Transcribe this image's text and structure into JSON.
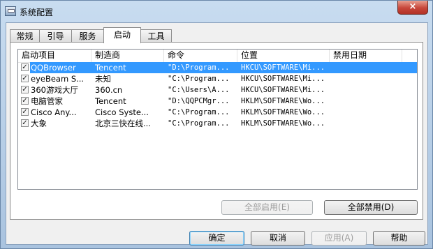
{
  "window": {
    "title": "系统配置",
    "close_symbol": "×"
  },
  "tabs": [
    {
      "label": "常规"
    },
    {
      "label": "引导"
    },
    {
      "label": "服务"
    },
    {
      "label": "启动",
      "active": true
    },
    {
      "label": "工具"
    }
  ],
  "startup_table": {
    "columns": [
      "启动项目",
      "制造商",
      "命令",
      "位置",
      "禁用日期"
    ],
    "rows": [
      {
        "checked": true,
        "item": "QQBrowser",
        "maker": "Tencent",
        "command": "\"D:\\Program...",
        "location": "HKCU\\SOFTWARE\\Mi...",
        "disabled_date": "",
        "selected": true
      },
      {
        "checked": true,
        "item": "eyeBeam S...",
        "maker": "未知",
        "command": "\"C:\\Program...",
        "location": "HKCU\\SOFTWARE\\Mi...",
        "disabled_date": ""
      },
      {
        "checked": true,
        "item": "360游戏大厅",
        "maker": "360.cn",
        "command": "\"C:\\Users\\A...",
        "location": "HKCU\\SOFTWARE\\Mi...",
        "disabled_date": ""
      },
      {
        "checked": true,
        "item": "电脑管家",
        "maker": "Tencent",
        "command": "\"D:\\QQPCMgr...",
        "location": "HKLM\\SOFTWARE\\Wo...",
        "disabled_date": ""
      },
      {
        "checked": true,
        "item": "Cisco Any...",
        "maker": "Cisco Syste...",
        "command": "\"C:\\Program...",
        "location": "HKLM\\SOFTWARE\\Wo...",
        "disabled_date": ""
      },
      {
        "checked": true,
        "item": "大象",
        "maker": "北京三快在线...",
        "command": "\"C:\\Program...",
        "location": "HKLM\\SOFTWARE\\Wo...",
        "disabled_date": ""
      }
    ]
  },
  "panel_buttons": {
    "enable_all": "全部启用(E)",
    "disable_all": "全部禁用(D)"
  },
  "footer_buttons": {
    "ok": "确定",
    "cancel": "取消",
    "apply": "应用(A)",
    "help": "帮助"
  },
  "colors": {
    "selection": "#3399ff"
  },
  "icons": {
    "app": "system-config-icon",
    "checkbox": "checkmark-icon"
  }
}
